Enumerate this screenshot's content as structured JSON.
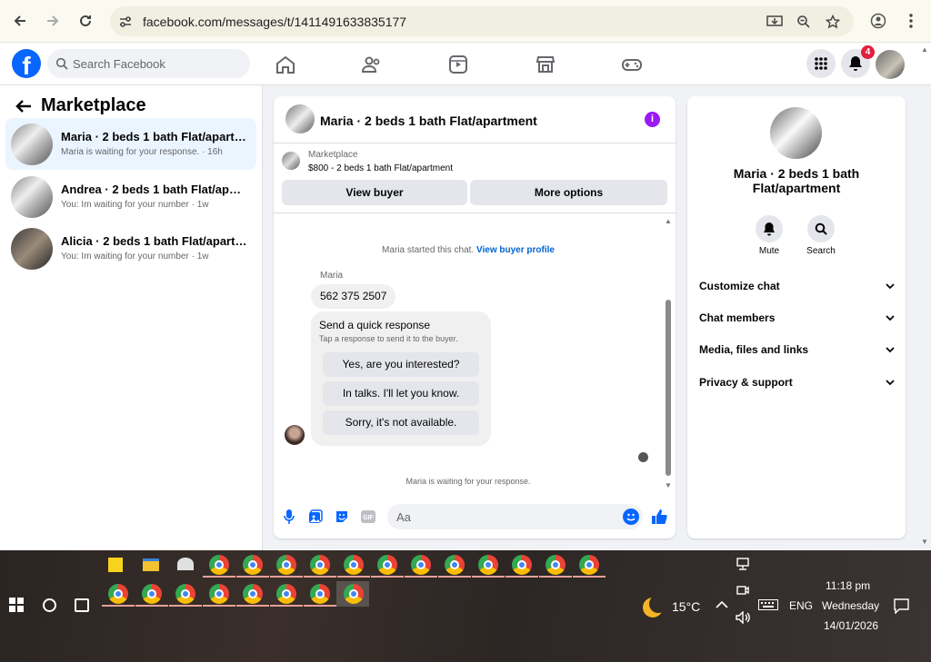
{
  "browser": {
    "url": "facebook.com/messages/t/1411491633835177"
  },
  "header": {
    "search_placeholder": "Search Facebook",
    "notification_count": "4"
  },
  "left_panel": {
    "title": "Marketplace",
    "conversations": [
      {
        "name": "Maria · 2 beds 1 bath Flat/apartment",
        "subtitle": "Maria is waiting for your response. · 16h",
        "active": true
      },
      {
        "name": "Andrea · 2 beds 1 bath Flat/apartment",
        "subtitle": "You: Im waiting for your number · 1w",
        "active": false
      },
      {
        "name": "Alicia · 2 beds 1 bath Flat/apartment",
        "subtitle": "You: Im waiting for your number · 1w",
        "active": false
      }
    ]
  },
  "chat": {
    "title": "Maria · 2 beds 1 bath Flat/apartment",
    "info_glyph": "i",
    "listing_label": "Marketplace",
    "listing_price": "$800 - 2 beds 1 bath Flat/apartment",
    "view_buyer_label": "View buyer",
    "more_options_label": "More options",
    "system_message": "Maria started this chat.",
    "view_profile_link": "View buyer profile",
    "sender": "Maria",
    "phone_message": "562 375 2507",
    "quick_title": "Send a quick response",
    "quick_subtitle": "Tap a response to send it to the buyer.",
    "quick_responses": [
      "Yes, are you interested?",
      "In talks. I'll let you know.",
      "Sorry, it's not available."
    ],
    "waiting_message": "Maria is waiting for your response.",
    "input_placeholder": "Aa"
  },
  "info_panel": {
    "title": "Maria · 2 beds 1 bath Flat/apartment",
    "mute_label": "Mute",
    "search_label": "Search",
    "sections": [
      "Customize chat",
      "Chat members",
      "Media, files and links",
      "Privacy & support"
    ]
  },
  "taskbar": {
    "temperature": "15°C",
    "language": "ENG",
    "time": "11:18 pm",
    "day": "Wednesday",
    "date": "14/01/2026"
  },
  "colors": {
    "fb_blue": "#0866ff",
    "active_conv_bg": "#ebf5ff",
    "badge_red": "#e41e3f",
    "info_purple": "#9b19f5"
  }
}
